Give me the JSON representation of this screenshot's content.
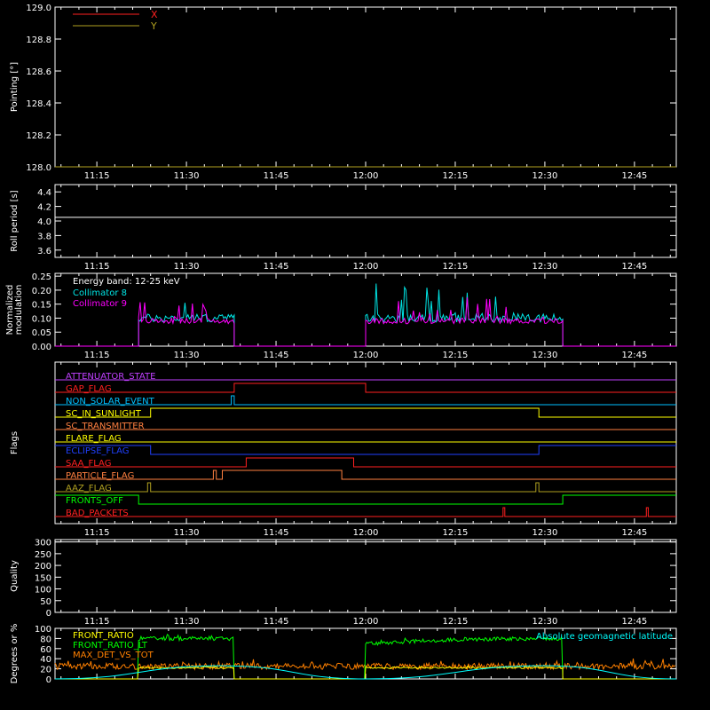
{
  "chart_data": [
    {
      "type": "line",
      "ylabel": "Pointing [°]",
      "yticks": [
        "128.0",
        "128.2",
        "128.4",
        "128.6",
        "128.8",
        "129.0"
      ],
      "ylim": [
        128.0,
        129.0
      ],
      "xticks": [
        "11:15",
        "11:30",
        "11:45",
        "12:00",
        "12:15",
        "12:30",
        "12:45"
      ],
      "legend": "top-left",
      "series": [
        {
          "name": "X",
          "color": "#ff2020",
          "x": [
            "11:08",
            "12:52"
          ],
          "values": [
            127.99,
            127.99
          ]
        },
        {
          "name": "Y",
          "color": "#b0a020",
          "x": [
            "11:08",
            "12:52"
          ],
          "values": [
            127.99,
            127.99
          ]
        }
      ]
    },
    {
      "type": "line",
      "ylabel": "Roll period [s]",
      "yticks": [
        "3.6",
        "3.8",
        "4.0",
        "4.2",
        "4.4"
      ],
      "ylim": [
        3.5,
        4.5
      ],
      "xticks": [
        "11:15",
        "11:30",
        "11:45",
        "12:00",
        "12:15",
        "12:30",
        "12:45"
      ],
      "series": [
        {
          "color": "#ffffff",
          "x": [
            "11:08",
            "12:52"
          ],
          "values": [
            4.05,
            4.05
          ]
        }
      ]
    },
    {
      "type": "line",
      "ylabel": [
        "Normalized",
        "modulation"
      ],
      "yticks": [
        "0.00",
        "0.05",
        "0.10",
        "0.15",
        "0.20",
        "0.25"
      ],
      "ylim": [
        0,
        0.26
      ],
      "xticks": [
        "11:15",
        "11:30",
        "11:45",
        "12:00",
        "12:15",
        "12:30",
        "12:45"
      ],
      "annotation": "Energy band: 12-25 keV",
      "legend": "top-left",
      "series": [
        {
          "name": "Collimator 8",
          "color": "#00e5e5",
          "x": [
            "11:08",
            "11:22",
            "11:22",
            "11:38",
            "11:38",
            "12:00",
            "12:00",
            "12:33",
            "12:33",
            "12:52"
          ],
          "values": [
            0,
            0,
            0.1,
            0.1,
            0,
            0,
            0.1,
            0.1,
            0,
            0
          ]
        },
        {
          "name": "Collimator 9",
          "color": "#ff00ff",
          "x": [
            "11:08",
            "11:22",
            "11:22",
            "11:38",
            "11:38",
            "12:00",
            "12:00",
            "12:33",
            "12:33",
            "12:52"
          ],
          "values": [
            0,
            0,
            0.09,
            0.09,
            0,
            0,
            0.09,
            0.09,
            0,
            0
          ]
        }
      ]
    },
    {
      "type": "line",
      "ylabel": "Flags",
      "xticks": [
        "11:15",
        "11:30",
        "11:45",
        "12:00",
        "12:15",
        "12:30",
        "12:45"
      ],
      "flags": [
        {
          "name": "ATTENUATOR_STATE",
          "color": "#c040ff",
          "t": [
            "11:08",
            "12:52"
          ],
          "v": [
            0,
            0
          ]
        },
        {
          "name": "GAP_FLAG",
          "color": "#ff2020",
          "t": [
            "11:08",
            "11:38",
            "11:38",
            "12:00",
            "12:00",
            "12:52"
          ],
          "v": [
            0,
            0,
            1,
            1,
            0,
            0
          ]
        },
        {
          "name": "NON_SOLAR_EVENT",
          "color": "#00c0ff",
          "t": [
            "11:08",
            "11:37.5",
            "11:37.5",
            "11:38",
            "11:38",
            "12:52"
          ],
          "v": [
            0,
            0,
            1,
            1,
            0,
            0
          ]
        },
        {
          "name": "SC_IN_SUNLIGHT",
          "color": "#ffff00",
          "t": [
            "11:08",
            "11:24",
            "11:24",
            "12:29",
            "12:29",
            "12:52"
          ],
          "v": [
            0,
            0,
            1,
            1,
            0,
            0
          ]
        },
        {
          "name": "SC_TRANSMITTER",
          "color": "#ff8040",
          "t": [
            "11:08",
            "12:52"
          ],
          "v": [
            0,
            0
          ]
        },
        {
          "name": "FLARE_FLAG",
          "color": "#ffff00",
          "t": [
            "11:08",
            "12:52"
          ],
          "v": [
            0,
            0
          ]
        },
        {
          "name": "ECLIPSE_FLAG",
          "color": "#2040ff",
          "t": [
            "11:08",
            "11:24",
            "11:24",
            "12:29",
            "12:29",
            "12:52"
          ],
          "v": [
            1,
            1,
            0,
            0,
            1,
            1
          ]
        },
        {
          "name": "SAA_FLAG",
          "color": "#ff2020",
          "t": [
            "11:08",
            "11:40",
            "11:40",
            "11:58",
            "11:58",
            "12:52"
          ],
          "v": [
            0,
            0,
            1,
            1,
            0,
            0
          ]
        },
        {
          "name": "PARTICLE_FLAG",
          "color": "#ff8040",
          "t": [
            "11:08",
            "11:34.5",
            "11:34.5",
            "11:35",
            "11:35",
            "11:36",
            "11:36",
            "11:56",
            "11:56",
            "12:52"
          ],
          "v": [
            0,
            0,
            1,
            1,
            0,
            0,
            1,
            1,
            0,
            0
          ]
        },
        {
          "name": "AAZ_FLAG",
          "color": "#b0a020",
          "t": [
            "11:08",
            "11:23.5",
            "11:23.5",
            "11:24",
            "11:24",
            "12:28.5",
            "12:28.5",
            "12:29",
            "12:29",
            "12:52"
          ],
          "v": [
            0,
            0,
            1,
            1,
            0,
            0,
            1,
            1,
            0,
            0
          ]
        },
        {
          "name": "FRONTS_OFF",
          "color": "#00ff00",
          "t": [
            "11:08",
            "11:22",
            "11:22",
            "12:33",
            "12:33",
            "12:52"
          ],
          "v": [
            1,
            1,
            0,
            0,
            1,
            1
          ]
        },
        {
          "name": "BAD_PACKETS",
          "color": "#ff2020",
          "t": [
            "11:08",
            "12:23",
            "12:23",
            "12:23.3",
            "12:23.3",
            "12:47",
            "12:47",
            "12:47.3",
            "12:47.3",
            "12:52"
          ],
          "v": [
            0,
            0,
            1,
            1,
            0,
            0,
            1,
            1,
            0,
            0
          ]
        }
      ]
    },
    {
      "type": "line",
      "ylabel": "Quality",
      "yticks": [
        "0",
        "50",
        "100",
        "150",
        "200",
        "250",
        "300"
      ],
      "ylim": [
        0,
        310
      ],
      "xticks": [
        "11:15",
        "11:30",
        "11:45",
        "12:00",
        "12:15",
        "12:30",
        "12:45"
      ],
      "series": [
        {
          "color": "#ffffff",
          "x": [
            "11:08",
            "12:52"
          ],
          "values": [
            300,
            300
          ]
        }
      ]
    },
    {
      "type": "line",
      "ylabel": "Degrees or %",
      "yticks": [
        "0",
        "20",
        "40",
        "60",
        "80",
        "100"
      ],
      "ylim": [
        0,
        100
      ],
      "annotation": "Absolute geomagnetic latitude",
      "legend": "top-left",
      "series": [
        {
          "name": "FRONT_RATIO",
          "color": "#ffff00",
          "x": [
            "11:08",
            "11:22",
            "11:22",
            "11:38",
            "11:38",
            "12:00",
            "12:00",
            "12:33",
            "12:33",
            "12:52"
          ],
          "values": [
            0,
            0,
            22,
            22,
            0,
            0,
            22,
            22,
            0,
            0
          ]
        },
        {
          "name": "FRONT_RATIO_LT",
          "color": "#00ff00",
          "x": [
            "11:08",
            "11:22",
            "11:22",
            "11:38",
            "11:38",
            "12:00",
            "12:00",
            "12:15",
            "12:33",
            "12:33",
            "12:52"
          ],
          "values": [
            0,
            0,
            80,
            80,
            0,
            0,
            70,
            78,
            80,
            0,
            0
          ]
        },
        {
          "name": "MAX_DET_VS_TOT",
          "color": "#ff8000",
          "x": [
            "11:08",
            "11:22",
            "11:38",
            "12:00",
            "12:33",
            "12:52"
          ],
          "values": [
            25,
            25,
            25,
            25,
            25,
            25
          ]
        },
        {
          "name": "Absolute geomagnetic latitude",
          "color": "#00ffff",
          "x": [
            "11:08",
            "11:36",
            "12:00",
            "12:30",
            "12:52"
          ],
          "values": [
            0,
            26,
            0,
            26,
            0
          ]
        }
      ]
    }
  ]
}
